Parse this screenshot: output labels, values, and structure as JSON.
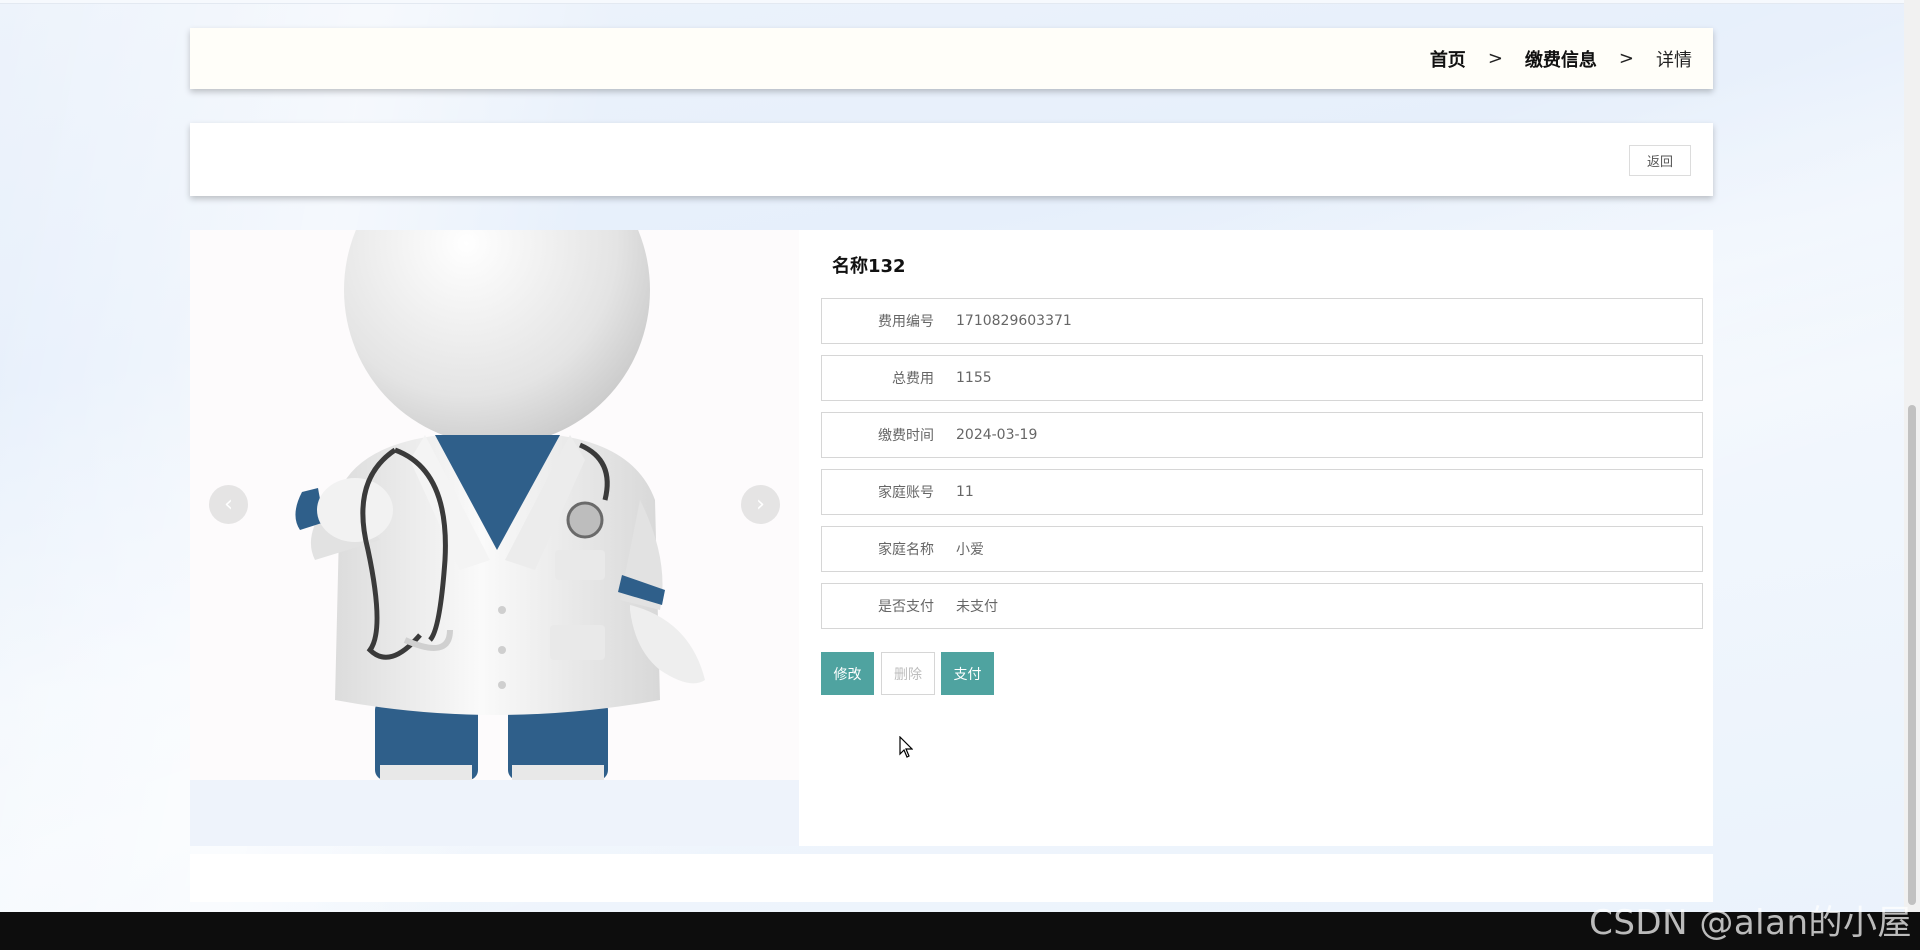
{
  "breadcrumb": {
    "home": "首页",
    "section": "缴费信息",
    "current": "详情",
    "separator": ">"
  },
  "actions": {
    "back_label": "返回"
  },
  "carousel": {
    "prev_symbol": "‹",
    "next_symbol": "›"
  },
  "detail": {
    "title": "名称132",
    "fields": [
      {
        "label": "费用编号",
        "value": "1710829603371"
      },
      {
        "label": "总费用",
        "value": "1155"
      },
      {
        "label": "缴费时间",
        "value": "2024-03-19"
      },
      {
        "label": "家庭账号",
        "value": "11"
      },
      {
        "label": "家庭名称",
        "value": "小爱"
      },
      {
        "label": "是否支付",
        "value": "未支付"
      }
    ],
    "buttons": {
      "edit": "修改",
      "delete": "删除",
      "pay": "支付"
    }
  },
  "watermark": "CSDN @alan的小屋",
  "colors": {
    "accent": "#4fa3a0",
    "coat_blue": "#2f5f8a"
  }
}
